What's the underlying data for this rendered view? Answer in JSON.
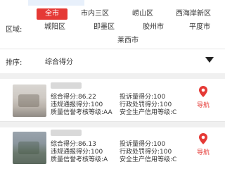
{
  "region": {
    "label": "区域:",
    "options": [
      "全市",
      "市内三区",
      "崂山区",
      "西海岸新区",
      "城阳区",
      "即墨区",
      "胶州市",
      "平度市",
      "莱西市"
    ],
    "selected": "全市"
  },
  "sort": {
    "label": "排序:",
    "value": "综合得分"
  },
  "results": [
    {
      "score": "综合得分:86.22",
      "violation": "违规通报得分:100",
      "quality": "质量信誉考核等级:AA",
      "complaint": "投诉量得分:100",
      "penalty": "行政处罚得分:100",
      "safety": "安全生产信用等级:C",
      "nav_label": "导航"
    },
    {
      "score": "综合得分:86.13",
      "violation": "违规通报得分:100",
      "quality": "质量信誉考核等级:A",
      "complaint": "投诉量得分:100",
      "penalty": "行政处罚得分:100",
      "safety": "安全生产信用等级:C",
      "nav_label": "导航"
    }
  ],
  "colors": {
    "accent": "#e53935"
  }
}
